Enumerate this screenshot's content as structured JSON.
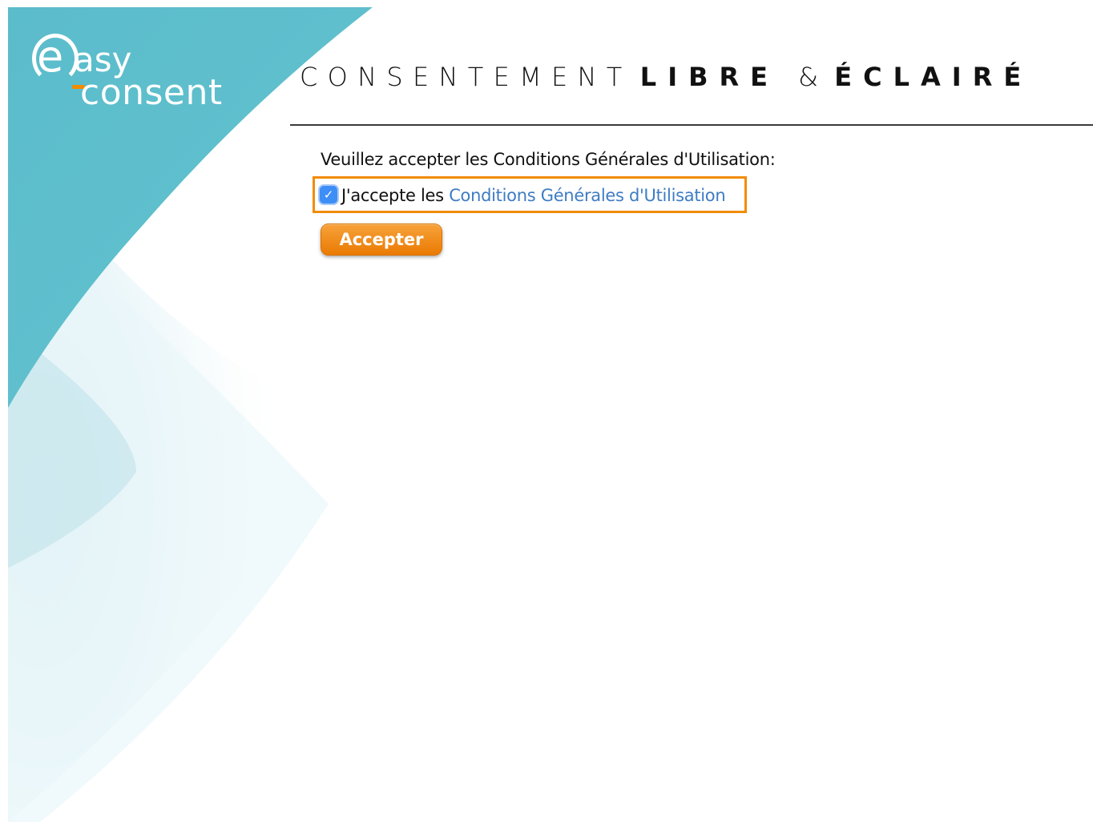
{
  "logo": {
    "e": "e",
    "asy": "asy",
    "consent": "consent"
  },
  "header": {
    "title_light": "CONSENTEMENT",
    "title_bold_1": "LIBRE",
    "title_amp": "&",
    "title_bold_2": "ÉCLAIRÉ"
  },
  "form": {
    "prompt": "Veuillez accepter les Conditions Générales d'Utilisation:",
    "checkbox_checked": true,
    "checkbox_label_prefix": "J'accepte les ",
    "terms_link_label": "Conditions Générales d'Utilisation",
    "accept_button_label": "Accepter"
  },
  "colors": {
    "brand_teal": "#5fbfcc",
    "accent_orange": "#f28c00",
    "link_blue": "#3e7cc4",
    "checkbox_blue": "#3d8ef7"
  }
}
